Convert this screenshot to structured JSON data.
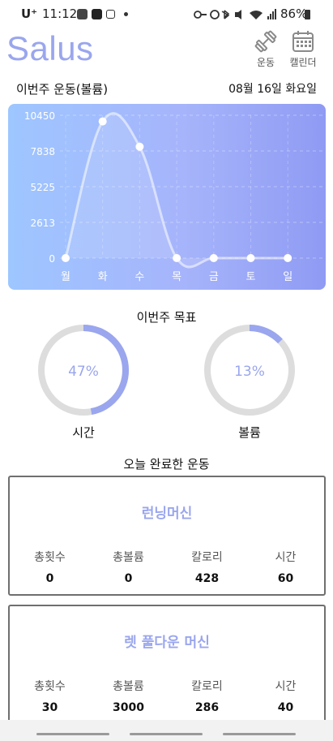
{
  "status_bar": {
    "carrier": "U⁺",
    "time": "11:12",
    "battery": "86%",
    "icons": [
      "talk-icon",
      "puzzle-icon",
      "screenshot-icon",
      "dot-icon",
      "key-icon",
      "alarm-icon",
      "bluetooth-icon",
      "mute-icon",
      "wifi-icon",
      "signal-icon",
      "battery-icon"
    ]
  },
  "header": {
    "app_title": "Salus",
    "exercise_label": "운동",
    "calendar_label": "캘린더"
  },
  "weekly": {
    "title": "이번주 운동(볼륨)",
    "date": "08월 16일 화요일"
  },
  "chart_data": {
    "type": "line",
    "categories": [
      "월",
      "화",
      "수",
      "목",
      "금",
      "토",
      "일"
    ],
    "values": [
      0,
      10000,
      8150,
      0,
      0,
      0,
      0
    ],
    "ytick_labels": [
      "10450",
      "7838",
      "5225",
      "2613",
      "0"
    ],
    "yticks": [
      10450,
      7838,
      5225,
      2613,
      0
    ],
    "ylim": [
      0,
      10450
    ],
    "grid": true
  },
  "goals": {
    "title": "이번주 목표",
    "time": {
      "label": "시간",
      "percent_text": "47%",
      "fraction": 0.47
    },
    "volume": {
      "label": "볼륨",
      "percent_text": "13%",
      "fraction": 0.13
    }
  },
  "completed": {
    "title": "오늘 완료한 운동",
    "stat_headers": [
      "총횟수",
      "총볼륨",
      "칼로리",
      "시간"
    ],
    "exercises": [
      {
        "name": "런닝머신",
        "values": [
          "0",
          "0",
          "428",
          "60"
        ]
      },
      {
        "name": "렛 풀다운 머신",
        "values": [
          "30",
          "3000",
          "286",
          "40"
        ]
      }
    ]
  },
  "colors": {
    "accent": "#9aa6ee",
    "ring_track": "#dddddd",
    "chart_from": "#9ec6ff",
    "chart_to": "#8f9bf3"
  }
}
